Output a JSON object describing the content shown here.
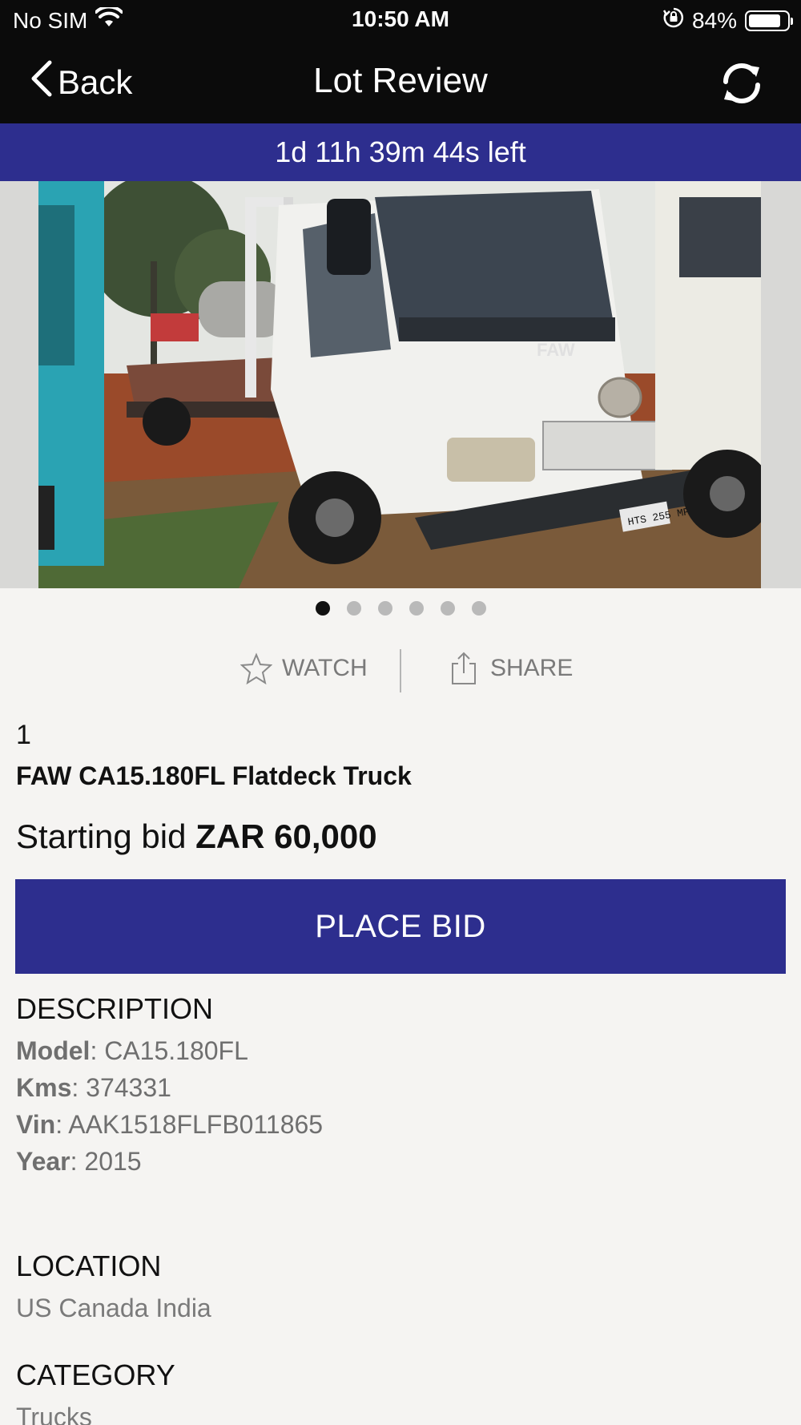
{
  "status_bar": {
    "carrier": "No SIM",
    "time": "10:50 AM",
    "battery": "84%",
    "battery_level": 0.84
  },
  "nav": {
    "back_label": "Back",
    "title": "Lot Review"
  },
  "countdown": "1d 11h 39m 44s left",
  "gallery": {
    "total_images": 6,
    "active_index": 0
  },
  "actions": {
    "watch_label": "WATCH",
    "share_label": "SHARE"
  },
  "lot": {
    "number": "1",
    "title": "FAW CA15.180FL Flatdeck Truck",
    "starting_bid_prefix": "Starting bid",
    "starting_bid_value": "ZAR 60,000"
  },
  "place_bid_label": "PLACE BID",
  "description": {
    "heading": "DESCRIPTION",
    "fields": [
      {
        "key": "Model",
        "value": "CA15.180FL"
      },
      {
        "key": "Kms",
        "value": "374331"
      },
      {
        "key": "Vin",
        "value": "AAK1518FLFB011865"
      },
      {
        "key": "Year",
        "value": "2015"
      }
    ]
  },
  "location": {
    "heading": "LOCATION",
    "value": "US Canada India"
  },
  "category": {
    "heading": "CATEGORY",
    "value": "Trucks"
  },
  "colors": {
    "brand": "#2d2e8e",
    "bar": "#0b0b0b",
    "background": "#f5f4f2"
  },
  "photo_plate": "HTS 255 MP",
  "photo_brand": "FAW"
}
